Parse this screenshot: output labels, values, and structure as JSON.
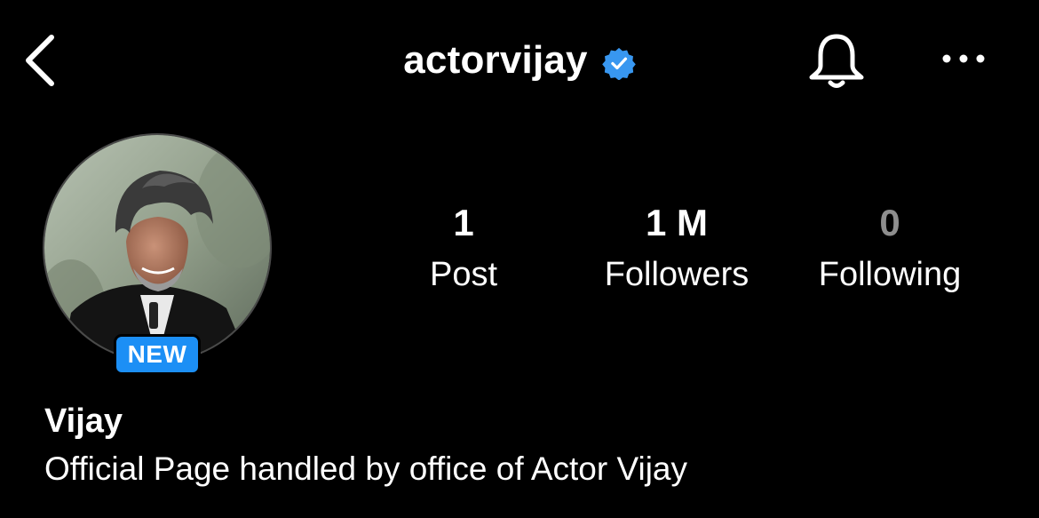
{
  "header": {
    "username": "actorvijay",
    "verified_color": "#3897f0"
  },
  "icons": {
    "back": "chevron-left-icon",
    "verified": "verified-badge-icon",
    "notifications": "bell-icon",
    "more": "more-horizontal-icon"
  },
  "profile": {
    "new_badge": "NEW",
    "badge_color": "#1c8ff5",
    "display_name": "Vijay",
    "bio": "Official Page handled by office of Actor Vijay"
  },
  "stats": {
    "posts": {
      "value": "1",
      "label": "Post"
    },
    "followers": {
      "value": "1 M",
      "label": "Followers"
    },
    "following": {
      "value": "0",
      "label": "Following"
    }
  }
}
